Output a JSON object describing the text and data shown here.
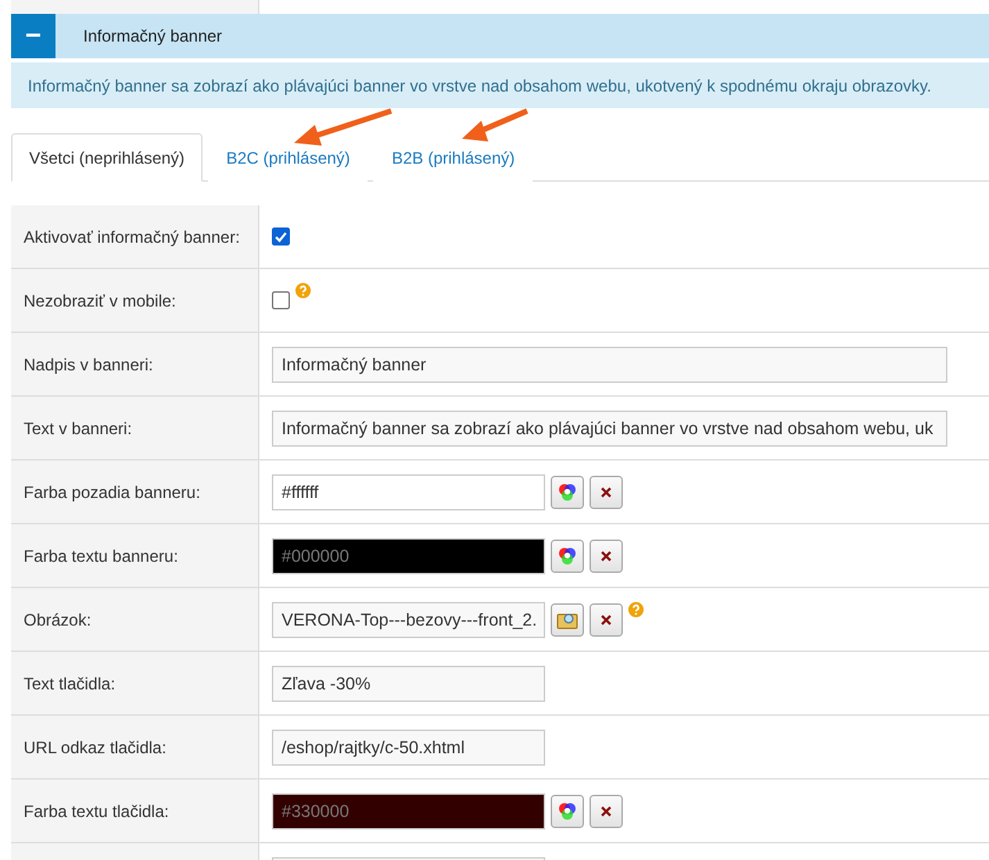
{
  "panel": {
    "title": "Informačný banner",
    "toggle": "−",
    "info": "Informačný banner sa zobrazí ako plávajúci banner vo vrstve nad obsahom webu, ukotvený k spodnému okraju obrazovky."
  },
  "tabs": [
    {
      "label": "Všetci (neprihlásený)",
      "selected": true
    },
    {
      "label": "B2C (prihlásený)",
      "selected": false
    },
    {
      "label": "B2B (prihlásený)",
      "selected": false
    }
  ],
  "rows": [
    {
      "kind": "checkbox",
      "label": "Aktivovať informačný banner:",
      "checked": true,
      "help": false
    },
    {
      "kind": "checkbox",
      "label": "Nezobraziť v mobile:",
      "checked": false,
      "help": true
    },
    {
      "kind": "text",
      "label": "Nadpis v banneri:",
      "value": "Informačný banner",
      "wide": true
    },
    {
      "kind": "text",
      "label": "Text v banneri:",
      "value": "Informačný banner sa zobrazí ako plávajúci banner vo vrstve nad obsahom webu, uk",
      "wide": true
    },
    {
      "kind": "color",
      "label": "Farba pozadia banneru:",
      "value": "#ffffff",
      "color": "#ffffff"
    },
    {
      "kind": "color",
      "label": "Farba textu banneru:",
      "value": "#000000",
      "color": "#000000"
    },
    {
      "kind": "image",
      "label": "Obrázok:",
      "value": "VERONA-Top---bezovy---front_2.",
      "help": true
    },
    {
      "kind": "text",
      "label": "Text tlačidla:",
      "value": "Zľava -30%",
      "wide": false
    },
    {
      "kind": "text",
      "label": "URL odkaz tlačidla:",
      "value": "/eshop/rajtky/c-50.xhtml",
      "wide": false
    },
    {
      "kind": "color",
      "label": "Farba textu tlačidla:",
      "value": "#330000",
      "color": "#330000"
    }
  ]
}
